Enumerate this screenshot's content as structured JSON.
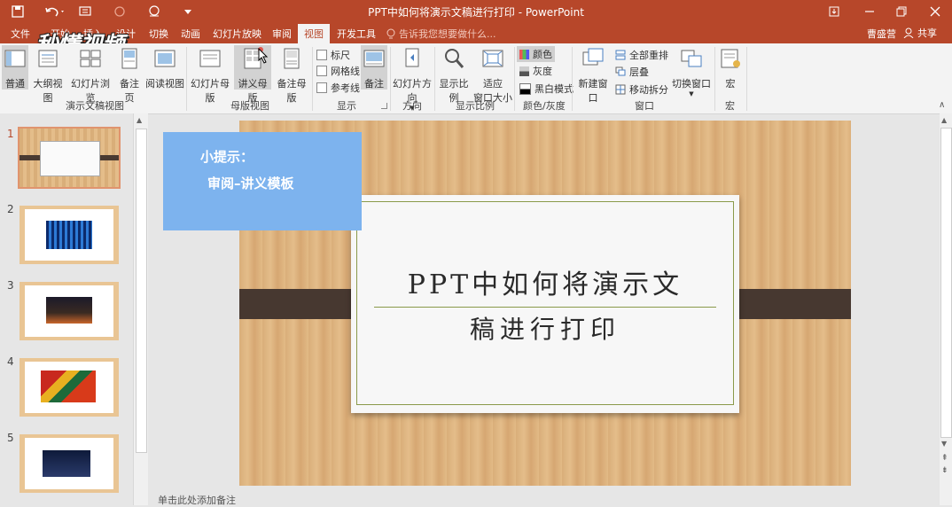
{
  "titlebar": {
    "title": "PPT中如何将演示文稿进行打印 - PowerPoint"
  },
  "tabs": [
    "文件",
    "开始",
    "插入",
    "设计",
    "切换",
    "动画",
    "幻灯片放映",
    "审阅",
    "视图",
    "开发工具"
  ],
  "active_tab": "视图",
  "tellme": "告诉我您想要做什么...",
  "user": "曹盛营",
  "share": "共享",
  "watermark": "秒懂视频",
  "ribbon": {
    "views": [
      "普通",
      "大纲视图",
      "幻灯片浏览",
      "备注页",
      "阅读视图"
    ],
    "group_views": "演示文稿视图",
    "masters": [
      "幻灯片母版",
      "讲义母版",
      "备注母版"
    ],
    "group_masters": "母版视图",
    "show": [
      "标尺",
      "网格线",
      "参考线"
    ],
    "notes_btn": "备注",
    "group_show": "显示",
    "orientation": "幻灯片方向",
    "group_direction": "方向",
    "zoom": "显示比例",
    "fit": [
      "适应",
      "窗口大小"
    ],
    "group_zoom": "显示比例",
    "colors": [
      "颜色",
      "灰度",
      "黑白模式"
    ],
    "group_color": "颜色/灰度",
    "new_window": "新建窗口",
    "window_cmds": [
      "全部重排",
      "层叠",
      "移动拆分"
    ],
    "switch_window": "切换窗口",
    "group_window": "窗口",
    "macro": "宏",
    "group_macro": "宏"
  },
  "slides": [
    "1",
    "2",
    "3",
    "4",
    "5"
  ],
  "tip": {
    "line1": "小提示：",
    "line2": "审阅–讲义模板"
  },
  "slide_title": {
    "line1": "PPT中如何将演示文",
    "line2": "稿进行打印"
  },
  "notes_placeholder": "单击此处添加备注",
  "colors": {
    "accent": "#b7472a",
    "tip_bg": "#7db3ee"
  }
}
